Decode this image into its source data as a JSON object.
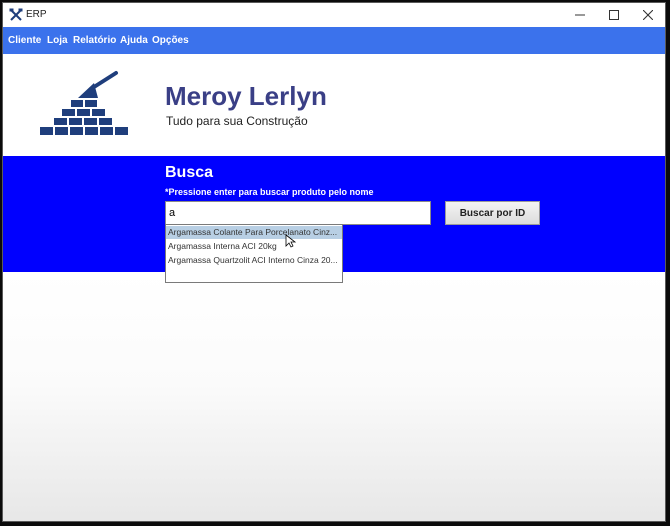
{
  "window": {
    "title": "ERP",
    "icon": "tools-icon",
    "controls": [
      "minimize-icon",
      "maximize-icon",
      "close-icon"
    ]
  },
  "menu": {
    "items": [
      "Cliente",
      "Loja",
      "Relatório",
      "Ajuda",
      "Opções"
    ]
  },
  "header": {
    "logo": "brick-wall-trowel-icon",
    "company_name": "Meroy Lerlyn",
    "slogan": "Tudo para sua Construção"
  },
  "search": {
    "title": "Busca",
    "hint": "*Pressione enter para buscar produto pelo nome",
    "input_value": "a",
    "button_label": "Buscar por ID"
  },
  "suggestions": {
    "selected_index": 0,
    "items": [
      "Argamassa Colante Para Porcelanato Cinz...",
      "Argamassa Interna ACI 20kg",
      "Argamassa Quartzolit ACI Interno Cinza 20..."
    ]
  },
  "colors": {
    "menubar": "#3b72ec",
    "search_band": "#0000ff",
    "company_name": "#3a3f86",
    "logo_brick": "#1f3e7c",
    "selection": "#b8cfe4"
  }
}
